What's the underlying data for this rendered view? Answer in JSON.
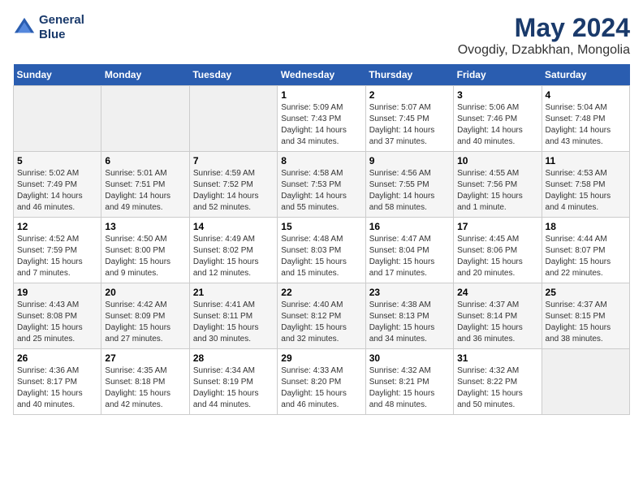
{
  "header": {
    "logo_line1": "General",
    "logo_line2": "Blue",
    "month_year": "May 2024",
    "location": "Ovogdiy, Dzabkhan, Mongolia"
  },
  "days_of_week": [
    "Sunday",
    "Monday",
    "Tuesday",
    "Wednesday",
    "Thursday",
    "Friday",
    "Saturday"
  ],
  "weeks": [
    [
      {
        "day": "",
        "info": ""
      },
      {
        "day": "",
        "info": ""
      },
      {
        "day": "",
        "info": ""
      },
      {
        "day": "1",
        "info": "Sunrise: 5:09 AM\nSunset: 7:43 PM\nDaylight: 14 hours\nand 34 minutes."
      },
      {
        "day": "2",
        "info": "Sunrise: 5:07 AM\nSunset: 7:45 PM\nDaylight: 14 hours\nand 37 minutes."
      },
      {
        "day": "3",
        "info": "Sunrise: 5:06 AM\nSunset: 7:46 PM\nDaylight: 14 hours\nand 40 minutes."
      },
      {
        "day": "4",
        "info": "Sunrise: 5:04 AM\nSunset: 7:48 PM\nDaylight: 14 hours\nand 43 minutes."
      }
    ],
    [
      {
        "day": "5",
        "info": "Sunrise: 5:02 AM\nSunset: 7:49 PM\nDaylight: 14 hours\nand 46 minutes."
      },
      {
        "day": "6",
        "info": "Sunrise: 5:01 AM\nSunset: 7:51 PM\nDaylight: 14 hours\nand 49 minutes."
      },
      {
        "day": "7",
        "info": "Sunrise: 4:59 AM\nSunset: 7:52 PM\nDaylight: 14 hours\nand 52 minutes."
      },
      {
        "day": "8",
        "info": "Sunrise: 4:58 AM\nSunset: 7:53 PM\nDaylight: 14 hours\nand 55 minutes."
      },
      {
        "day": "9",
        "info": "Sunrise: 4:56 AM\nSunset: 7:55 PM\nDaylight: 14 hours\nand 58 minutes."
      },
      {
        "day": "10",
        "info": "Sunrise: 4:55 AM\nSunset: 7:56 PM\nDaylight: 15 hours\nand 1 minute."
      },
      {
        "day": "11",
        "info": "Sunrise: 4:53 AM\nSunset: 7:58 PM\nDaylight: 15 hours\nand 4 minutes."
      }
    ],
    [
      {
        "day": "12",
        "info": "Sunrise: 4:52 AM\nSunset: 7:59 PM\nDaylight: 15 hours\nand 7 minutes."
      },
      {
        "day": "13",
        "info": "Sunrise: 4:50 AM\nSunset: 8:00 PM\nDaylight: 15 hours\nand 9 minutes."
      },
      {
        "day": "14",
        "info": "Sunrise: 4:49 AM\nSunset: 8:02 PM\nDaylight: 15 hours\nand 12 minutes."
      },
      {
        "day": "15",
        "info": "Sunrise: 4:48 AM\nSunset: 8:03 PM\nDaylight: 15 hours\nand 15 minutes."
      },
      {
        "day": "16",
        "info": "Sunrise: 4:47 AM\nSunset: 8:04 PM\nDaylight: 15 hours\nand 17 minutes."
      },
      {
        "day": "17",
        "info": "Sunrise: 4:45 AM\nSunset: 8:06 PM\nDaylight: 15 hours\nand 20 minutes."
      },
      {
        "day": "18",
        "info": "Sunrise: 4:44 AM\nSunset: 8:07 PM\nDaylight: 15 hours\nand 22 minutes."
      }
    ],
    [
      {
        "day": "19",
        "info": "Sunrise: 4:43 AM\nSunset: 8:08 PM\nDaylight: 15 hours\nand 25 minutes."
      },
      {
        "day": "20",
        "info": "Sunrise: 4:42 AM\nSunset: 8:09 PM\nDaylight: 15 hours\nand 27 minutes."
      },
      {
        "day": "21",
        "info": "Sunrise: 4:41 AM\nSunset: 8:11 PM\nDaylight: 15 hours\nand 30 minutes."
      },
      {
        "day": "22",
        "info": "Sunrise: 4:40 AM\nSunset: 8:12 PM\nDaylight: 15 hours\nand 32 minutes."
      },
      {
        "day": "23",
        "info": "Sunrise: 4:38 AM\nSunset: 8:13 PM\nDaylight: 15 hours\nand 34 minutes."
      },
      {
        "day": "24",
        "info": "Sunrise: 4:37 AM\nSunset: 8:14 PM\nDaylight: 15 hours\nand 36 minutes."
      },
      {
        "day": "25",
        "info": "Sunrise: 4:37 AM\nSunset: 8:15 PM\nDaylight: 15 hours\nand 38 minutes."
      }
    ],
    [
      {
        "day": "26",
        "info": "Sunrise: 4:36 AM\nSunset: 8:17 PM\nDaylight: 15 hours\nand 40 minutes."
      },
      {
        "day": "27",
        "info": "Sunrise: 4:35 AM\nSunset: 8:18 PM\nDaylight: 15 hours\nand 42 minutes."
      },
      {
        "day": "28",
        "info": "Sunrise: 4:34 AM\nSunset: 8:19 PM\nDaylight: 15 hours\nand 44 minutes."
      },
      {
        "day": "29",
        "info": "Sunrise: 4:33 AM\nSunset: 8:20 PM\nDaylight: 15 hours\nand 46 minutes."
      },
      {
        "day": "30",
        "info": "Sunrise: 4:32 AM\nSunset: 8:21 PM\nDaylight: 15 hours\nand 48 minutes."
      },
      {
        "day": "31",
        "info": "Sunrise: 4:32 AM\nSunset: 8:22 PM\nDaylight: 15 hours\nand 50 minutes."
      },
      {
        "day": "",
        "info": ""
      }
    ]
  ]
}
